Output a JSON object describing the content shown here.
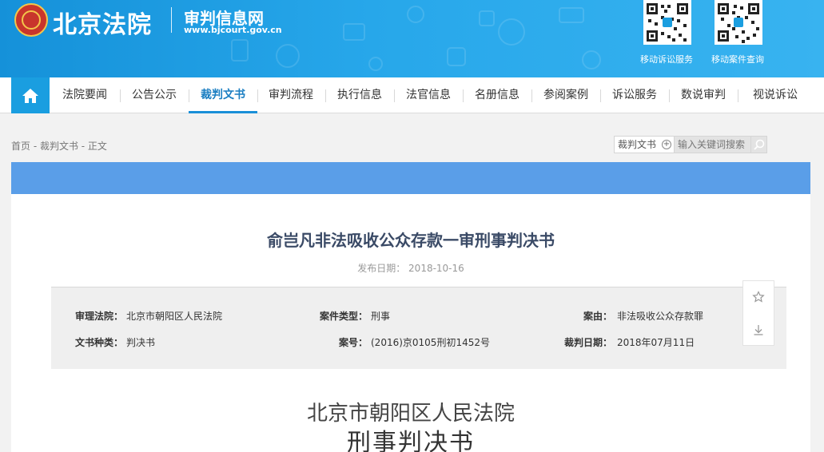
{
  "header": {
    "logo_text": "北京法院",
    "site_title": "审判信息网",
    "site_url": "www.bjcourt.gov.cn",
    "qr_codes": [
      {
        "label": "移动诉讼服务"
      },
      {
        "label": "移动案件查询"
      }
    ],
    "brand_color": "#1a9ee0"
  },
  "nav": {
    "home_icon": "home-icon",
    "items": [
      {
        "label": "法院要闻"
      },
      {
        "label": "公告公示"
      },
      {
        "label": "裁判文书",
        "active": true
      },
      {
        "label": "审判流程"
      },
      {
        "label": "执行信息"
      },
      {
        "label": "法官信息"
      },
      {
        "label": "名册信息"
      },
      {
        "label": "参阅案例"
      },
      {
        "label": "诉讼服务"
      },
      {
        "label": "数说审判"
      },
      {
        "label": "视说诉讼"
      }
    ]
  },
  "breadcrumb": "首页 - 裁判文书 - 正文",
  "search": {
    "category": "裁判文书",
    "placeholder": "输入关键词搜索"
  },
  "document": {
    "title": "俞岂凡非法吸收公众存款一审刑事判决书",
    "publish_label": "发布日期：",
    "publish_date": "2018-10-16",
    "meta": {
      "court_label": "审理法院：",
      "court_value": "北京市朝阳区人民法院",
      "case_type_label": "案件类型：",
      "case_type_value": "刑事",
      "cause_label": "案由：",
      "cause_value": "非法吸收公众存款罪",
      "doc_type_label": "文书种类：",
      "doc_type_value": "判决书",
      "case_no_label": "案号：",
      "case_no_value": "(2016)京0105刑初1452号",
      "judge_date_label": "裁判日期：",
      "judge_date_value": "2018年07月11日"
    },
    "court_name": "北京市朝阳区人民法院",
    "doc_kind": "刑事判决书"
  },
  "tools": {
    "favorite_icon": "star-icon",
    "download_icon": "download-icon"
  }
}
